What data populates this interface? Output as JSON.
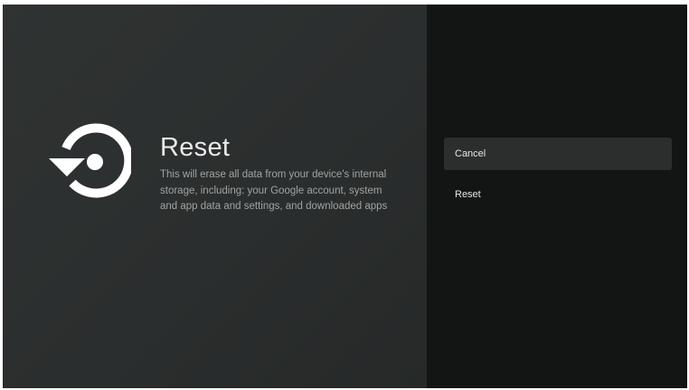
{
  "dialog": {
    "icon": "reset-restore-icon",
    "title": "Reset",
    "description": "This will erase all data from your device's internal storage, including: your Google account, system and app data and settings, and downloaded apps"
  },
  "actions": {
    "items": [
      {
        "label": "Cancel",
        "focused": true
      },
      {
        "label": "Reset",
        "focused": false
      }
    ]
  },
  "colors": {
    "left_panel": "#2d3130",
    "right_panel": "#131414",
    "focused_item": "#2c2e2e",
    "title_text": "#e9ebea",
    "description_text": "#9fa3a2"
  }
}
